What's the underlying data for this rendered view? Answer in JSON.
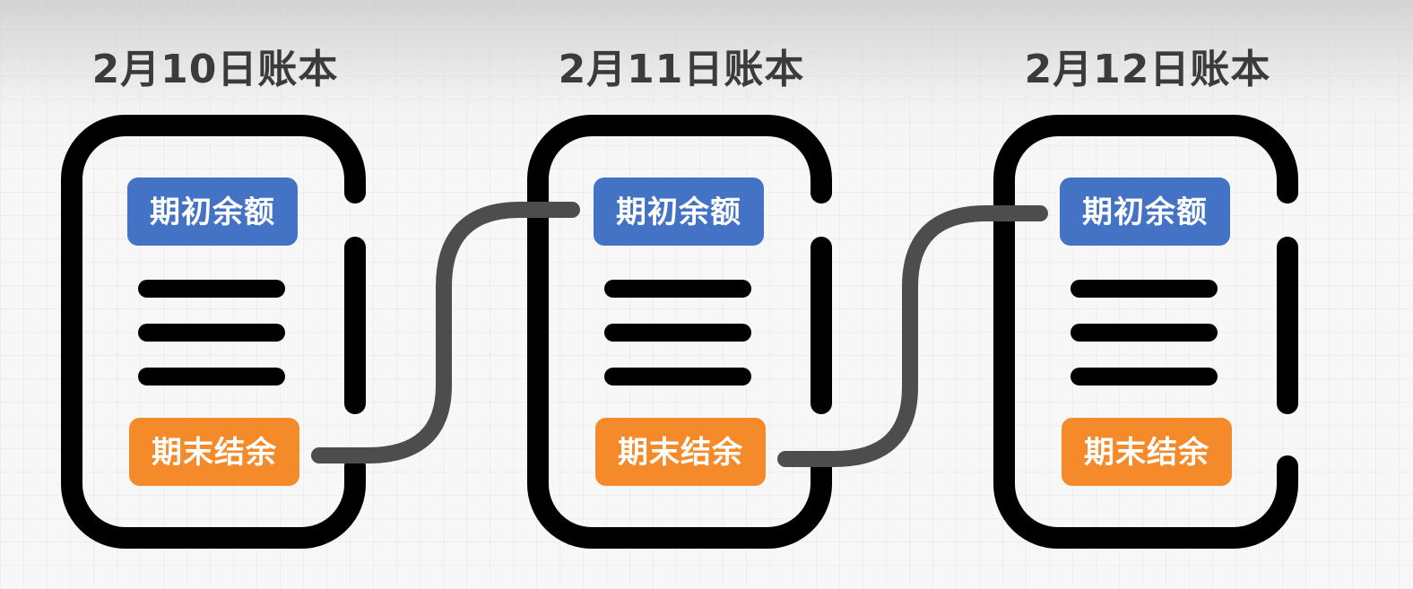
{
  "colors": {
    "opening_pill": "#4472C4",
    "closing_pill": "#F58A2A",
    "ledger_outline": "#000000",
    "connector": "#4d4d4d",
    "title_text": "#3b3b3b"
  },
  "ledgers": [
    {
      "title": "2月10日账本",
      "opening_label": "期初余额",
      "closing_label": "期末结余"
    },
    {
      "title": "2月11日账本",
      "opening_label": "期初余额",
      "closing_label": "期末结余"
    },
    {
      "title": "2月12日账本",
      "opening_label": "期初余额",
      "closing_label": "期末结余"
    }
  ],
  "connections": [
    {
      "from": "ledgers.0.closing",
      "to": "ledgers.1.opening"
    },
    {
      "from": "ledgers.1.closing",
      "to": "ledgers.2.opening"
    }
  ]
}
